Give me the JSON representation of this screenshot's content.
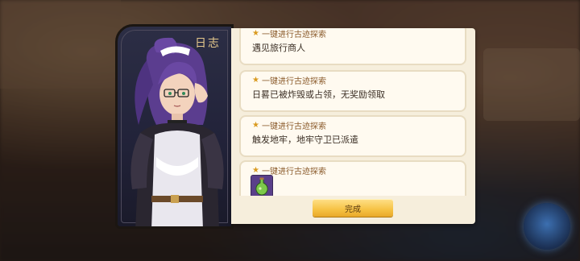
{
  "panel": {
    "title": "日志"
  },
  "log_entries": [
    {
      "header": "一键进行古迹探索",
      "text": "遇见旅行商人"
    },
    {
      "header": "一键进行古迹探索",
      "text": "日晷已被炸毁或占领，无奖励领取"
    },
    {
      "header": "一键进行古迹探索",
      "text": "触发地牢，地牢守卫已派遣"
    },
    {
      "header": "一键进行古迹探索",
      "reward_icon": "green-potion-icon"
    }
  ],
  "buttons": {
    "done_label": "完成"
  },
  "colors": {
    "accent": "#f6c244",
    "panel_bg": "#f6eedc",
    "header_text": "#8a5a2a",
    "title_gold": "#e6c98c"
  }
}
